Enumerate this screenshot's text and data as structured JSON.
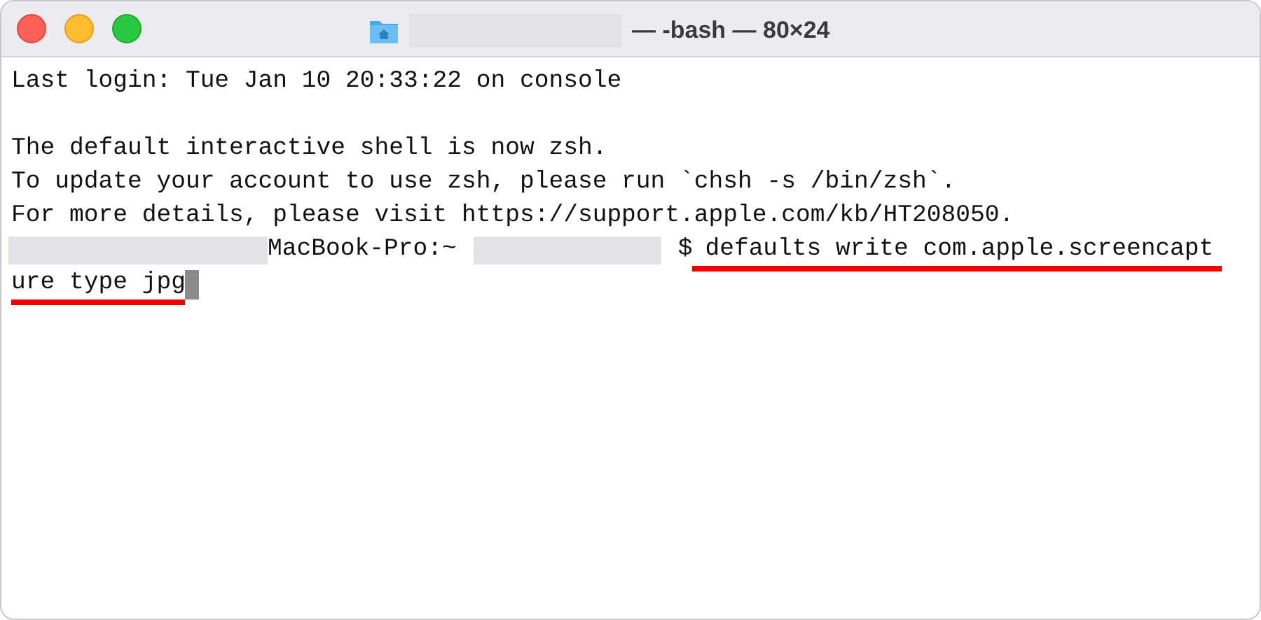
{
  "window": {
    "title": "— -bash — 80×24"
  },
  "terminal": {
    "lines": [
      {
        "kind": "text",
        "text": "Last login: Tue Jan 10 20:33:22 on console",
        "underlined": false,
        "cursor": false
      },
      {
        "kind": "blank"
      },
      {
        "kind": "text",
        "text": "The default interactive shell is now zsh.",
        "underlined": false,
        "cursor": false
      },
      {
        "kind": "text",
        "text": "To update your account to use zsh, please run `chsh -s /bin/zsh`.",
        "underlined": false,
        "cursor": false
      },
      {
        "kind": "text",
        "text": "For more details, please visit https://support.apple.com/kb/HT208050.",
        "underlined": false,
        "cursor": false
      },
      {
        "kind": "prompt",
        "host": "MacBook-Pro:~",
        "symbol": "$",
        "command": "defaults write com.apple.screencapt",
        "underlined": true
      },
      {
        "kind": "text",
        "text": "ure type jpg",
        "underlined": true,
        "cursor": true
      }
    ]
  }
}
